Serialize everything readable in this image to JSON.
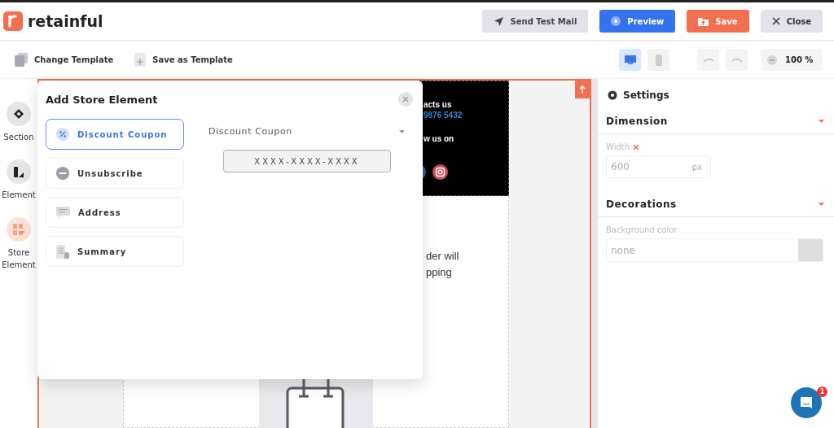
{
  "app": {
    "logo": "retainful"
  },
  "header_buttons": [
    {
      "kind": "send",
      "label": "Send Test Mail"
    },
    {
      "kind": "preview",
      "label": "Preview"
    },
    {
      "kind": "save",
      "label": "Save"
    },
    {
      "kind": "close",
      "label": "Close"
    }
  ],
  "toolbar": {
    "actions": [
      {
        "kind": "change",
        "label": "Change Template"
      },
      {
        "kind": "save-template",
        "label": "Save as Template"
      }
    ],
    "devices": [
      {
        "kind": "desktop",
        "selected": true
      },
      {
        "kind": "mobile",
        "selected": false
      }
    ],
    "zoom": "100 %"
  },
  "rail": [
    {
      "kind": "section",
      "label": "Section",
      "selected": false
    },
    {
      "kind": "element",
      "label": "Element",
      "selected": false
    },
    {
      "kind": "store",
      "label": "Store Element",
      "selected": true
    }
  ],
  "popup": {
    "title": "Add Store Element",
    "items": [
      {
        "kind": "coupon",
        "label": "Discount Coupon",
        "selected": true
      },
      {
        "kind": "unsubscribe",
        "label": "Unsubscribe",
        "selected": false
      },
      {
        "kind": "address",
        "label": "Address",
        "selected": false
      },
      {
        "kind": "summary",
        "label": "Summary",
        "selected": false
      }
    ],
    "dropdown": "Discount Coupon",
    "coupon_code": "XXXX-XXXX-XXXX"
  },
  "canvas": {
    "footer_lines": [
      {
        "kind": "heading",
        "text": "acts us"
      },
      {
        "kind": "link",
        "text": "9876 5432"
      },
      {
        "kind": "heading",
        "text": "w us on"
      }
    ],
    "body_lines": [
      "der will",
      "pping"
    ]
  },
  "settings": {
    "title": "Settings",
    "sections": [
      {
        "title": "Dimension",
        "field": {
          "kind": "unit",
          "label": "Width",
          "value": "600",
          "unit": "px"
        }
      },
      {
        "title": "Decorations",
        "field": {
          "kind": "color",
          "label": "Background color",
          "value": "none"
        }
      }
    ]
  },
  "chat": {
    "badge": "1"
  }
}
